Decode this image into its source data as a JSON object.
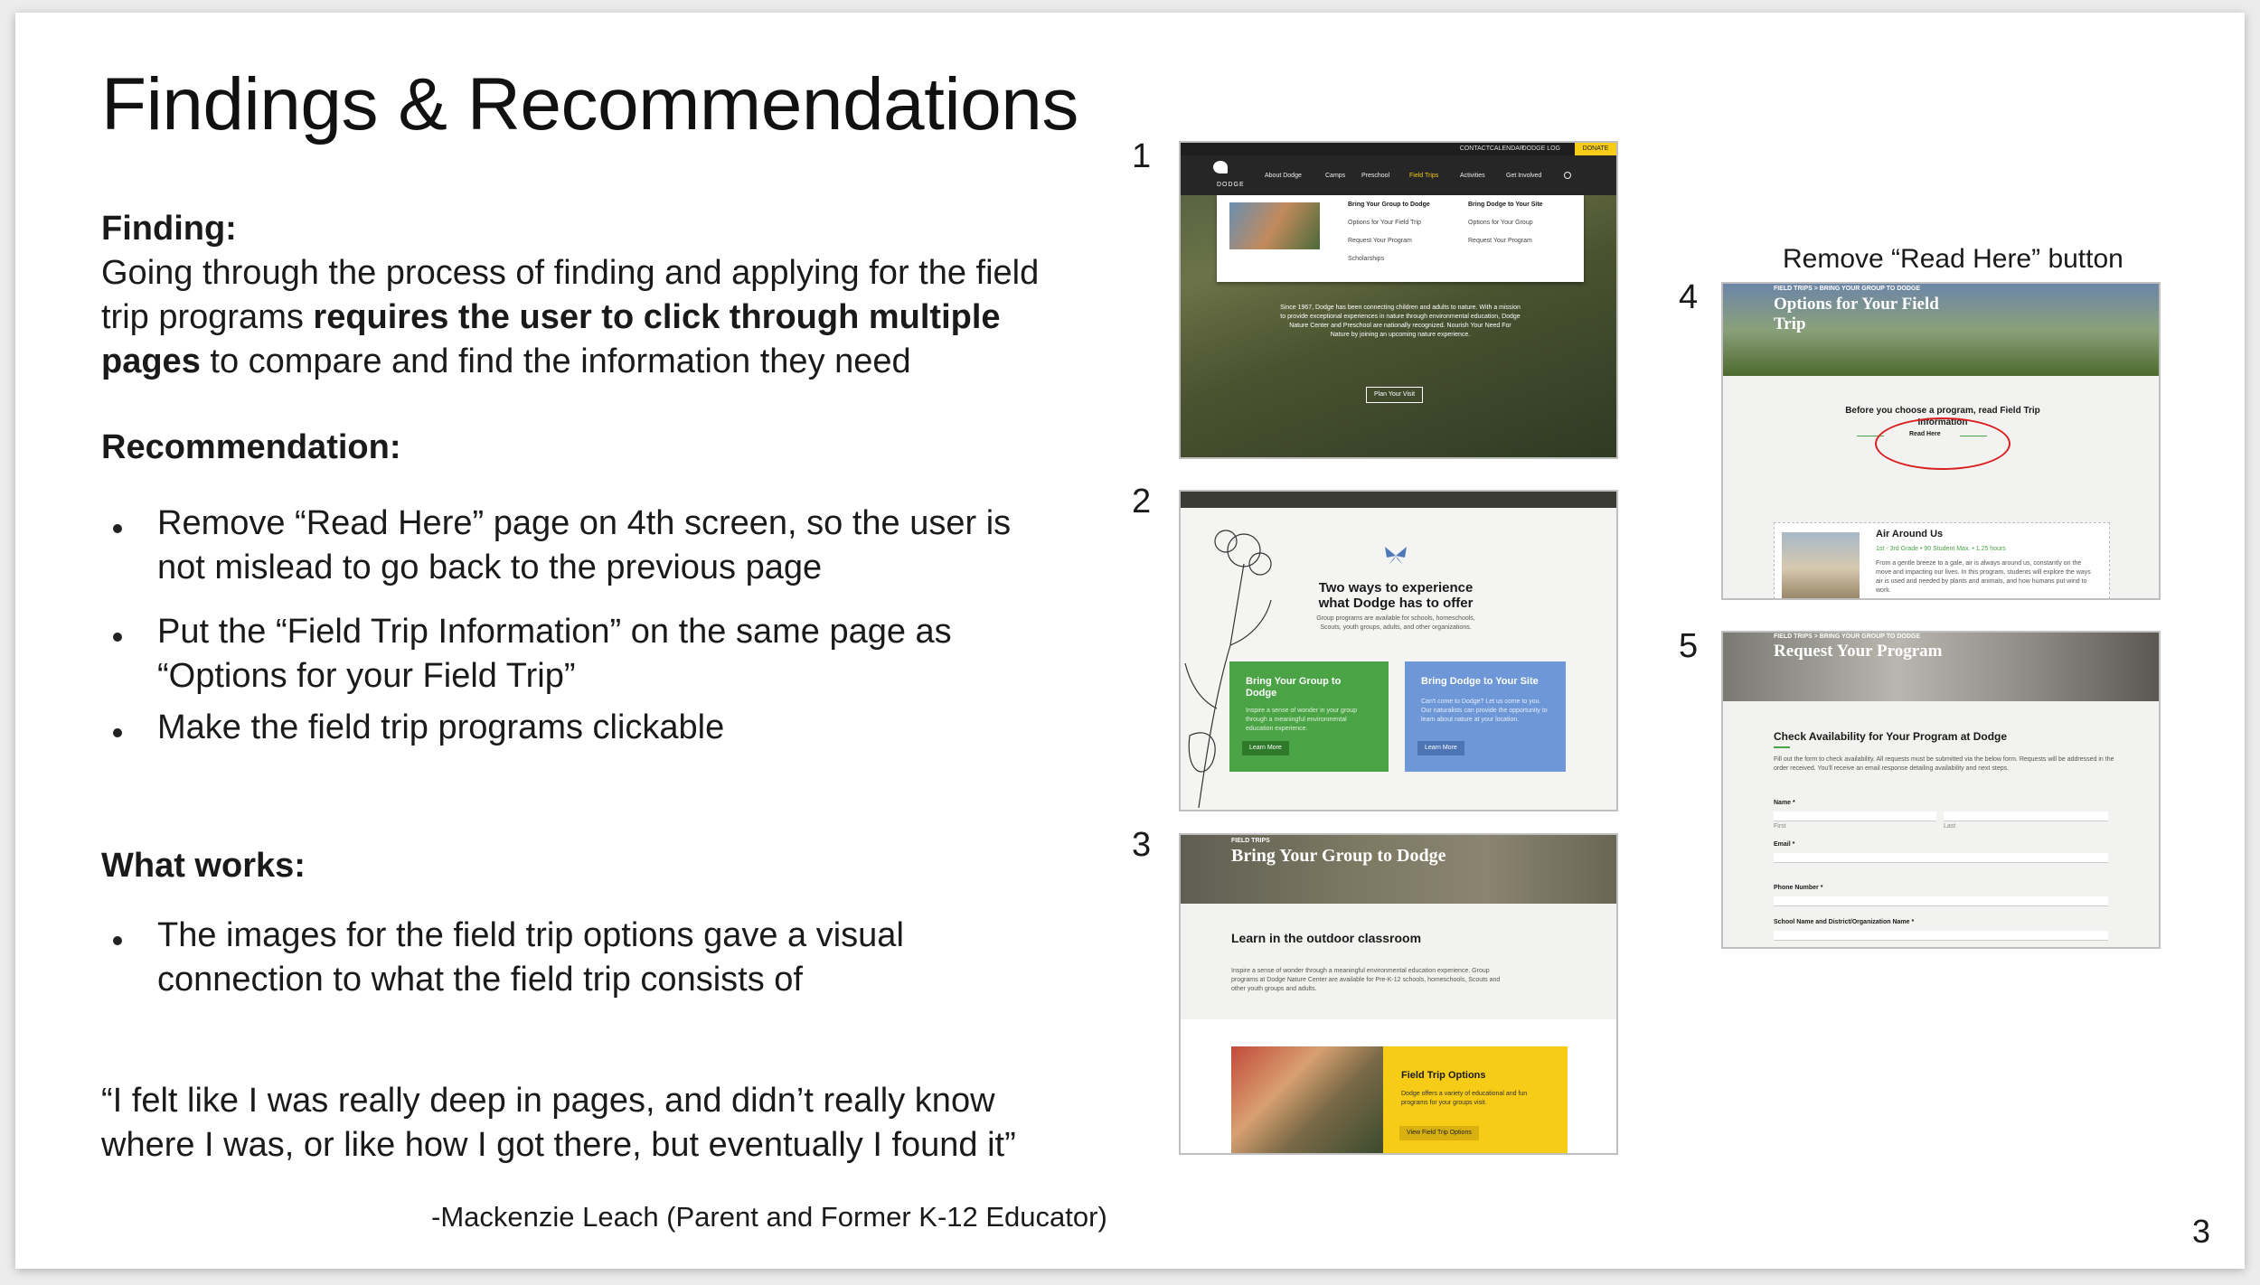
{
  "title": "Findings & Recommendations",
  "finding": {
    "heading": "Finding:",
    "line1": "Going through the process of finding and applying for the field",
    "line2_pre": "trip programs ",
    "line2_bold": "requires the user to click through multiple",
    "line3_bold": "pages",
    "line3_post": " to compare and find the information they need"
  },
  "recommendation": {
    "heading": "Recommendation:",
    "bullets": [
      {
        "line1": "Remove “Read Here” page on 4th screen, so the user is",
        "line2": "not mislead to go back to the previous page"
      },
      {
        "line1": "Put the “Field Trip Information” on the same page as",
        "line2": "“Options for your Field Trip”"
      },
      {
        "line1": "Make the field trip programs clickable",
        "line2": ""
      }
    ]
  },
  "what_works": {
    "heading": "What works:",
    "bullets": [
      {
        "line1": "The images for the field trip options gave a visual",
        "line2": "connection to what the field trip consists of"
      }
    ]
  },
  "quote": {
    "line1": "“I felt like I was really deep in pages, and didn’t really  know",
    "line2": "where I was, or like how I got there, but eventually I found it”",
    "attribution": "-Mackenzie Leach (Parent and Former K-12 Educator)"
  },
  "slide_number": "3",
  "screens": [
    {
      "number": "1",
      "nav_top": [
        "CONTACT",
        "CALENDAR",
        "DODGE LOG",
        "DONATE"
      ],
      "logo": "DODGE",
      "nav": [
        "About Dodge",
        "Camps",
        "Preschool",
        "Field Trips",
        "Activities",
        "Get Involved"
      ],
      "menu_col1_title": "Bring Your Group to Dodge",
      "menu_col1_items": [
        "Options for Your Field Trip",
        "Request Your Program",
        "Scholarships"
      ],
      "menu_col2_title": "Bring Dodge to Your Site",
      "menu_col2_items": [
        "Options for Your Group",
        "Request Your Program"
      ],
      "hero_text": "Since 1967, Dodge has been connecting children and adults to nature. With a mission to provide exceptional experiences in nature through environmental education, Dodge Nature Center and Preschool are nationally recognized. Nourish Your Need For Nature by joining an upcoming nature experience.",
      "cta": "Plan Your Visit"
    },
    {
      "number": "2",
      "heading": "Two ways to experience what Dodge has to offer",
      "sub": "Group programs are available for schools, homeschools, Scouts, youth groups, adults, and other organizations.",
      "card1_title": "Bring Your Group to Dodge",
      "card1_text": "Inspire a sense of wonder in your group through a meaningful environmental education experience.",
      "card1_btn": "Learn More",
      "card2_title": "Bring Dodge to Your Site",
      "card2_text": "Can't come to Dodge? Let us come to you. Our naturalists can provide the opportunity to learn about nature at your location.",
      "card2_btn": "Learn More"
    },
    {
      "number": "3",
      "kicker": "FIELD TRIPS",
      "banner": "Bring Your Group to Dodge",
      "heading": "Learn in the outdoor classroom",
      "text": "Inspire a sense of wonder through a meaningful environmental education experience. Group programs at Dodge Nature Center are available for Pre-K-12 schools, homeschools, Scouts and other youth groups and adults.",
      "card_title": "Field Trip Options",
      "card_text": "Dodge offers a variety of educational and fun programs for your groups visit.",
      "card_btn": "View Field Trip Options"
    },
    {
      "number": "4",
      "label": "Remove “Read Here” button",
      "kicker": "FIELD TRIPS  >  BRING YOUR GROUP TO DODGE",
      "banner": "Options for Your Field Trip",
      "intro": "Before you choose a program, read Field Trip Information",
      "btn": "Read Here",
      "program_title": "Air Around Us",
      "program_meta": "1st - 3rd Grade  •  90 Student Max.  •  1.25 hours",
      "program_text": "From a gentle breeze to a gale, air is always around us, constantly on the move and impacting our lives. In this program, students will explore the ways air is used and needed by plants and animals, and how humans put wind to work."
    },
    {
      "number": "5",
      "kicker": "FIELD TRIPS  >  BRING YOUR GROUP TO DODGE",
      "banner": "Request Your Program",
      "heading": "Check Availability for Your Program at Dodge",
      "text": "Fill out the form to check availability. All requests must be submitted via the below form. Requests will be addressed in the order received. You'll receive an email response detailing availability and next steps.",
      "fields": [
        "Name *",
        "Email *",
        "Phone Number *",
        "School Name and District/Organization Name *"
      ],
      "sub_first": "First",
      "sub_last": "Last"
    }
  ],
  "colors": {
    "green": "#4aa345",
    "blue": "#6d97d6",
    "yellow": "#f6cc16",
    "nav_dark": "#2b2b2b",
    "highlight_red": "#d81e1e",
    "accent_gold": "#e0a800"
  }
}
